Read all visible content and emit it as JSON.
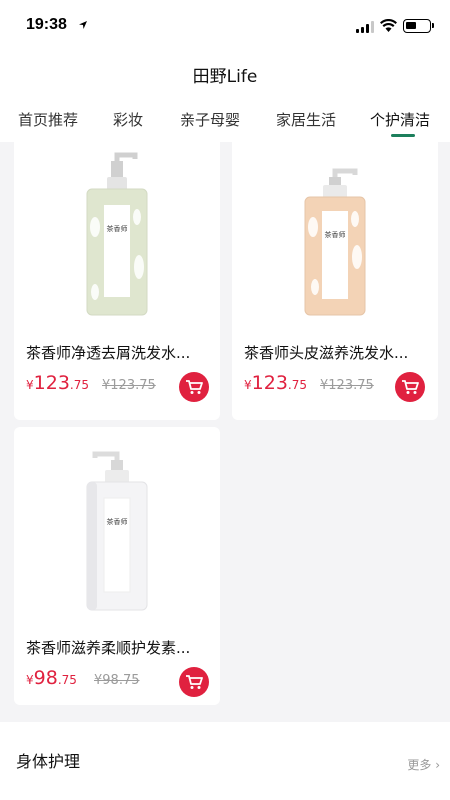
{
  "status_bar": {
    "time": "19:38"
  },
  "header": {
    "title": "田野Life"
  },
  "tabs": [
    {
      "label": "首页推荐"
    },
    {
      "label": "彩妆"
    },
    {
      "label": "亲子母婴"
    },
    {
      "label": "家居生活"
    },
    {
      "label": "个护清洁",
      "active": true
    }
  ],
  "products": [
    {
      "name": "茶香师净透去屑洗发水...",
      "price_symbol": "¥",
      "price_int": "123",
      "price_dec": ".75",
      "original_price": "¥123.75",
      "bottle_color": "#dfe6cf",
      "bottle_label": "茶香师"
    },
    {
      "name": "茶香师头皮滋养洗发水...",
      "price_symbol": "¥",
      "price_int": "123",
      "price_dec": ".75",
      "original_price": "¥123.75",
      "bottle_color": "#f3d3b6",
      "bottle_label": "茶香师"
    },
    {
      "name": "茶香师滋养柔顺护发素...",
      "price_symbol": "¥",
      "price_int": "98",
      "price_dec": ".75",
      "original_price": "¥98.75",
      "bottle_color": "#f4f4f6",
      "bottle_label": "茶香师"
    }
  ],
  "section": {
    "title": "身体护理",
    "more_label": "更多"
  },
  "colors": {
    "accent": "#1c7f5c",
    "price": "#e0213f"
  }
}
